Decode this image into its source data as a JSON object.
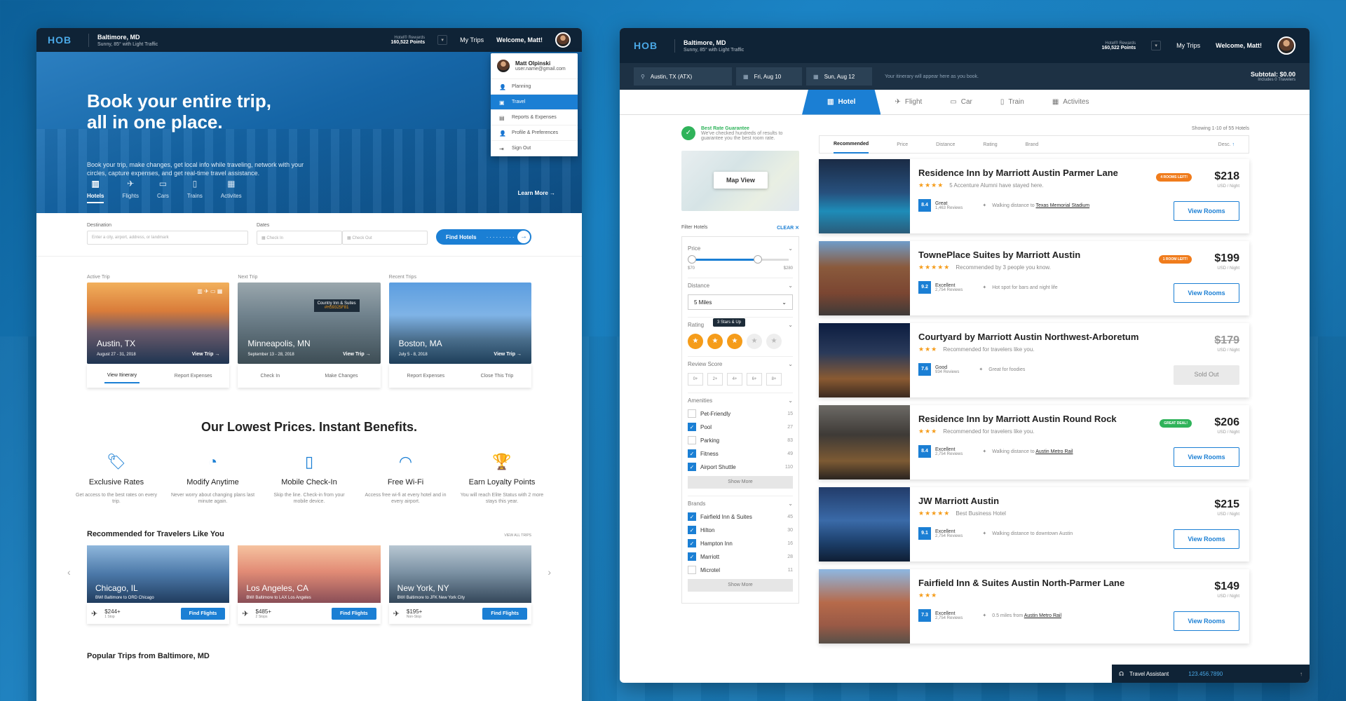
{
  "left": {
    "logo": "HOB",
    "location": {
      "city": "Baltimore, MD",
      "weather": "Sunny, 85° with Light Traffic"
    },
    "rewards": {
      "label": "Hotel® Rewards",
      "points": "160,522 Points"
    },
    "my_trips": "My Trips",
    "welcome": "Welcome, Matt!",
    "dropdown": {
      "name": "Matt Olpinski",
      "email": "user.name@gmail.com",
      "items": [
        {
          "label": "Planning",
          "icon": "user-icon"
        },
        {
          "label": "Travel",
          "icon": "suitcase-icon"
        },
        {
          "label": "Reports & Expenses",
          "icon": "document-icon"
        },
        {
          "label": "Profile & Preferences",
          "icon": "profile-icon"
        },
        {
          "label": "Sign Out",
          "icon": "sign-out-icon"
        }
      ]
    },
    "hero": {
      "title_line1": "Book your entire trip,",
      "title_line2": "all in one place.",
      "subtitle": "Book your trip, make changes, get local info while traveling, network with your circles, capture expenses, and get real-time travel assistance.",
      "nav": [
        "Hotels",
        "Flights",
        "Cars",
        "Trains",
        "Activites"
      ],
      "learn_more": "Learn More"
    },
    "search": {
      "destination_label": "Destination",
      "destination_placeholder": "Enter a city, airport, address, or landmark",
      "dates_label": "Dates",
      "check_in": "Check In",
      "check_out": "Check Out",
      "find_hotels": "Find Hotels"
    },
    "trips": [
      {
        "label": "Active Trip",
        "city": "Austin, TX",
        "dates": "August 27 - 31, 2018",
        "view": "View Trip",
        "actions": [
          "View Itinerary",
          "Report Expenses"
        ]
      },
      {
        "label": "Next Trip",
        "city": "Minneapolis, MN",
        "dates": "September 13 - 28, 2018",
        "view": "View Trip",
        "actions": [
          "Check In",
          "Make Changes"
        ]
      },
      {
        "label": "Recent Trips",
        "city": "Boston, MA",
        "dates": "July 5 - 8, 2018",
        "view": "View Trip",
        "actions": [
          "Report Expenses",
          "Close This Trip"
        ]
      }
    ],
    "tag": {
      "name": "Country Inn & Suites",
      "code": "#H59325F81"
    },
    "lowest_prices": "Our Lowest Prices. Instant Benefits.",
    "benefits": [
      {
        "title": "Exclusive Rates",
        "sub": "Get access to the best rates on every trip."
      },
      {
        "title": "Modify Anytime",
        "sub": "Never worry about changing plans last minute again."
      },
      {
        "title": "Mobile Check-In",
        "sub": "Skip the line. Check-in from your mobile device."
      },
      {
        "title": "Free Wi-Fi",
        "sub": "Access free wi-fi at every hotel and in every airport."
      },
      {
        "title": "Earn Loyalty Points",
        "sub": "You will reach Elite Status with 2 more stays this year."
      }
    ],
    "recommended_title": "Recommended for Travelers Like You",
    "view_all": "VIEW ALL TRIPS",
    "recommended": [
      {
        "city": "Chicago, IL",
        "route": "BWI Baltimore to ORD Chicago",
        "price": "$244+",
        "stops": "1 Stop",
        "button": "Find Flights"
      },
      {
        "city": "Los Angeles, CA",
        "route": "BWI Baltimore to LAX Los Angeles",
        "price": "$485+",
        "stops": "2 Stops",
        "button": "Find Flights"
      },
      {
        "city": "New York, NY",
        "route": "BWI Baltimore to JFK New York City",
        "price": "$195+",
        "stops": "Non-Stop",
        "button": "Find Flights"
      }
    ],
    "popular": "Popular Trips from Baltimore, MD"
  },
  "right": {
    "logo": "HOB",
    "location": {
      "city": "Baltimore, MD",
      "weather": "Sunny, 85° with Light Traffic"
    },
    "rewards": {
      "label": "Hotel® Rewards",
      "points": "160,522 Points"
    },
    "my_trips": "My Trips",
    "welcome": "Welcome, Matt!",
    "bar": {
      "destination": "Austin, TX (ATX)",
      "date_in": "Fri, Aug 10",
      "date_out": "Sun, Aug 12",
      "note": "Your itinerary will appear here as you book.",
      "subtotal": "Subtotal: $0.00",
      "travelers": "Includes 0 Travelers"
    },
    "tabs": [
      "Hotel",
      "Flight",
      "Car",
      "Train",
      "Activites"
    ],
    "best_rate": {
      "title": "Best Rate Guarantee",
      "sub": "We've checked hundreds of results to guarantee you the best room rate."
    },
    "map_view": "Map View",
    "filter_title": "Filter Hotels",
    "clear": "CLEAR",
    "price_filter": {
      "label": "Price",
      "min": "$70",
      "max": "$280",
      "low_frac": 0.0,
      "high_frac": 0.66
    },
    "distance": {
      "label": "Distance",
      "value": "5 Miles"
    },
    "rating": {
      "label": "Rating",
      "tooltip": "3 Stars & Up",
      "selected": 3,
      "options": [
        "1",
        "2",
        "3",
        "4",
        "5"
      ]
    },
    "review_score": {
      "label": "Review Score",
      "options": [
        "0+",
        "2+",
        "4+",
        "6+",
        "8+"
      ]
    },
    "amenities": {
      "label": "Amenities",
      "items": [
        {
          "name": "Pet-Friendly",
          "count": "15",
          "checked": false
        },
        {
          "name": "Pool",
          "count": "27",
          "checked": true
        },
        {
          "name": "Parking",
          "count": "83",
          "checked": false
        },
        {
          "name": "Fitness",
          "count": "49",
          "checked": true
        },
        {
          "name": "Airport Shuttle",
          "count": "110",
          "checked": true
        }
      ],
      "more": "Show More"
    },
    "brands": {
      "label": "Brands",
      "items": [
        {
          "name": "Fairfield Inn & Suites",
          "count": "45",
          "checked": true
        },
        {
          "name": "Hilton",
          "count": "30",
          "checked": true
        },
        {
          "name": "Hampton Inn",
          "count": "16",
          "checked": true
        },
        {
          "name": "Marriott",
          "count": "28",
          "checked": true
        },
        {
          "name": "Microtel",
          "count": "11",
          "checked": false
        }
      ],
      "more": "Show More"
    },
    "showing": "Showing 1-10 of 55 Hotels",
    "sort": [
      "Recommended",
      "Price",
      "Distance",
      "Rating",
      "Brand"
    ],
    "sort_dir": "Desc.",
    "hotels": [
      {
        "name": "Residence Inn by Marriott Austin Parmer Lane",
        "stars": "★★★★",
        "note": "5 Accenture Alumni have stayed here.",
        "score": "8.4",
        "score_label": "Great",
        "reviews": "1,463 Reviews",
        "feature_pre": "Walking distance to ",
        "feature_link": "Texas Memorial Stadium",
        "price": "$218",
        "unit": "USD / Night",
        "badge": "4 ROOMS LEFT!",
        "badge_color": "#f07c1c",
        "button": "View Rooms",
        "sold": false
      },
      {
        "name": "TownePlace Suites by Marriott Austin",
        "stars": "★★★★★",
        "note": "Recommended by 3 people you know.",
        "score": "9.2",
        "score_label": "Excellent",
        "reviews": "2,754 Reviews",
        "feature_pre": "Hot spot for bars and night life",
        "feature_link": "",
        "price": "$199",
        "unit": "USD / Night",
        "badge": "1 ROOM LEFT!",
        "badge_color": "#f07c1c",
        "button": "View Rooms",
        "sold": false
      },
      {
        "name": "Courtyard by Marriott Austin Northwest-Arboretum",
        "stars": "★★★",
        "note": "Recommended for travelers like you.",
        "score": "7.6",
        "score_label": "Good",
        "reviews": "934 Reviews",
        "feature_pre": "Great for foodies",
        "feature_link": "",
        "price": "$179",
        "unit": "USD / Night",
        "badge": "",
        "badge_color": "",
        "button": "Sold Out",
        "sold": true
      },
      {
        "name": "Residence Inn by Marriott Austin Round Rock",
        "stars": "★★★",
        "note": "Recommended for travelers like you.",
        "score": "8.4",
        "score_label": "Excellent",
        "reviews": "2,754 Reviews",
        "feature_pre": "Walking distance to ",
        "feature_link": "Austin Metro Rail",
        "price": "$206",
        "unit": "USD / Night",
        "badge": "GREAT DEAL!",
        "badge_color": "#2fb35a",
        "button": "View Rooms",
        "sold": false
      },
      {
        "name": "JW Marriott Austin",
        "stars": "★★★★★",
        "note": "Best Business Hotel",
        "score": "9.1",
        "score_label": "Excellent",
        "reviews": "2,754 Reviews",
        "feature_pre": "Walking distance to downtown Austin",
        "feature_link": "",
        "price": "$215",
        "unit": "USD / Night",
        "badge": "",
        "badge_color": "",
        "button": "View Rooms",
        "sold": false
      },
      {
        "name": "Fairfield Inn & Suites Austin North-Parmer Lane",
        "stars": "★★★",
        "note": "",
        "score": "7.3",
        "score_label": "Excellent",
        "reviews": "2,754 Reviews",
        "feature_pre": "0.5 miles from ",
        "feature_link": "Austin Metro Rail",
        "price": "$149",
        "unit": "USD / Night",
        "badge": "",
        "badge_color": "",
        "button": "View Rooms",
        "sold": false
      }
    ],
    "assistant": {
      "label": "Travel Assistant",
      "phone": "123.456.7890"
    }
  }
}
